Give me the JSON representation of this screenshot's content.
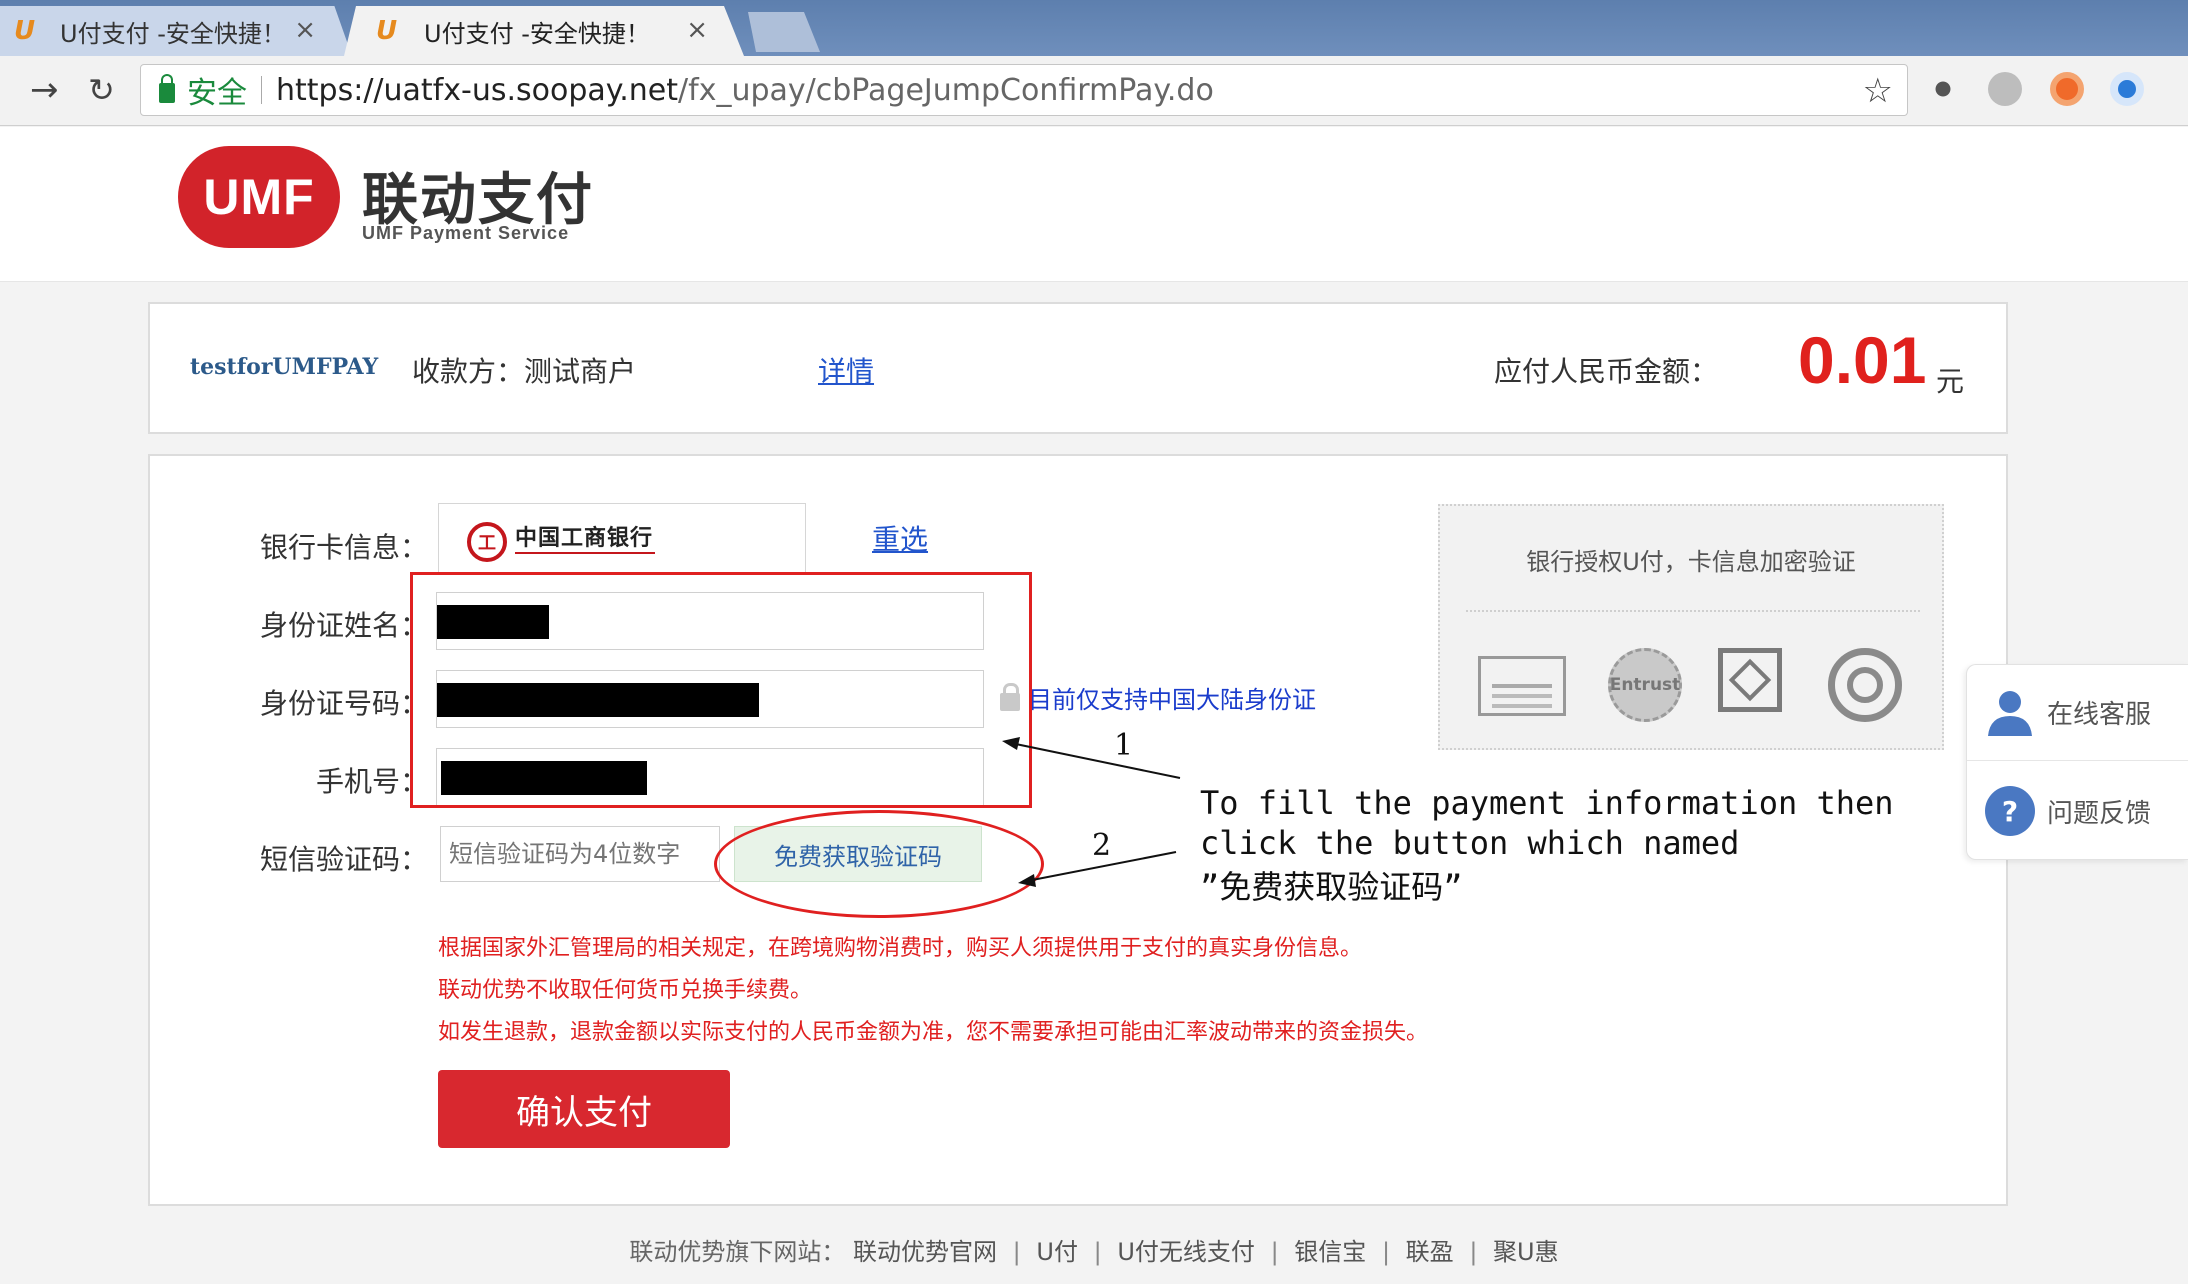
{
  "browser": {
    "tabs": [
      {
        "title": "U付支付 -安全快捷！",
        "close": "×",
        "icon": "ufu-favicon"
      },
      {
        "title": "U付支付 -安全快捷！",
        "close": "×",
        "icon": "ufu-favicon"
      }
    ],
    "secure_label": "安全",
    "url_host": "https://uatfx-us.soopay.net",
    "url_path": "/fx_upay/cbPageJumpConfirmPay.do"
  },
  "brand": {
    "logo_text": "UMF",
    "name_cn": "联动支付",
    "name_en": "UMF Payment Service",
    "accent": "#d2232a"
  },
  "order": {
    "merchant_id": "testforUMFPAY",
    "payee": "收款方：测试商户",
    "detail_link": "详情",
    "amount_label": "应付人民币金额：",
    "amount": "0.01",
    "currency": "元"
  },
  "form": {
    "bank_label": "银行卡信息：",
    "bank_name": "中国工商银行",
    "reselect": "重选",
    "id_name_label": "身份证姓名：",
    "id_number_label": "身份证号码：",
    "phone_label": "手机号：",
    "id_tip": "目前仅支持中国大陆身份证",
    "sms_label": "短信验证码：",
    "sms_placeholder": "短信验证码为4位数字",
    "sms_button": "免费获取验证码",
    "notices": [
      "根据国家外汇管理局的相关规定，在跨境购物消费时，购买人须提供用于支付的真实身份信息。",
      "联动优势不收取任何货币兑换手续费。",
      "如发生退款，退款金额以实际支付的人民币金额为准，您不需要承担可能由汇率波动带来的资金损失。"
    ],
    "confirm_button": "确认支付"
  },
  "security": {
    "title": "银行授权U付，卡信息加密验证",
    "certs": [
      "certificate-icon",
      "entrust-ssl-icon",
      "security-seal-icon",
      "circle-logo-icon"
    ],
    "entrust_text": "Entrust"
  },
  "side": {
    "online_service": "在线客服",
    "feedback": "问题反馈"
  },
  "footer": {
    "label": "联动优势旗下网站：",
    "links": [
      "联动优势官网",
      "U付",
      "U付无线支付",
      "银信宝",
      "联盈",
      "聚U惠"
    ]
  },
  "annotation": {
    "num1": "1",
    "num2": "2",
    "line1": "To fill the payment information then",
    "line2": "click the button which named",
    "line3": "”免费获取验证码”"
  }
}
